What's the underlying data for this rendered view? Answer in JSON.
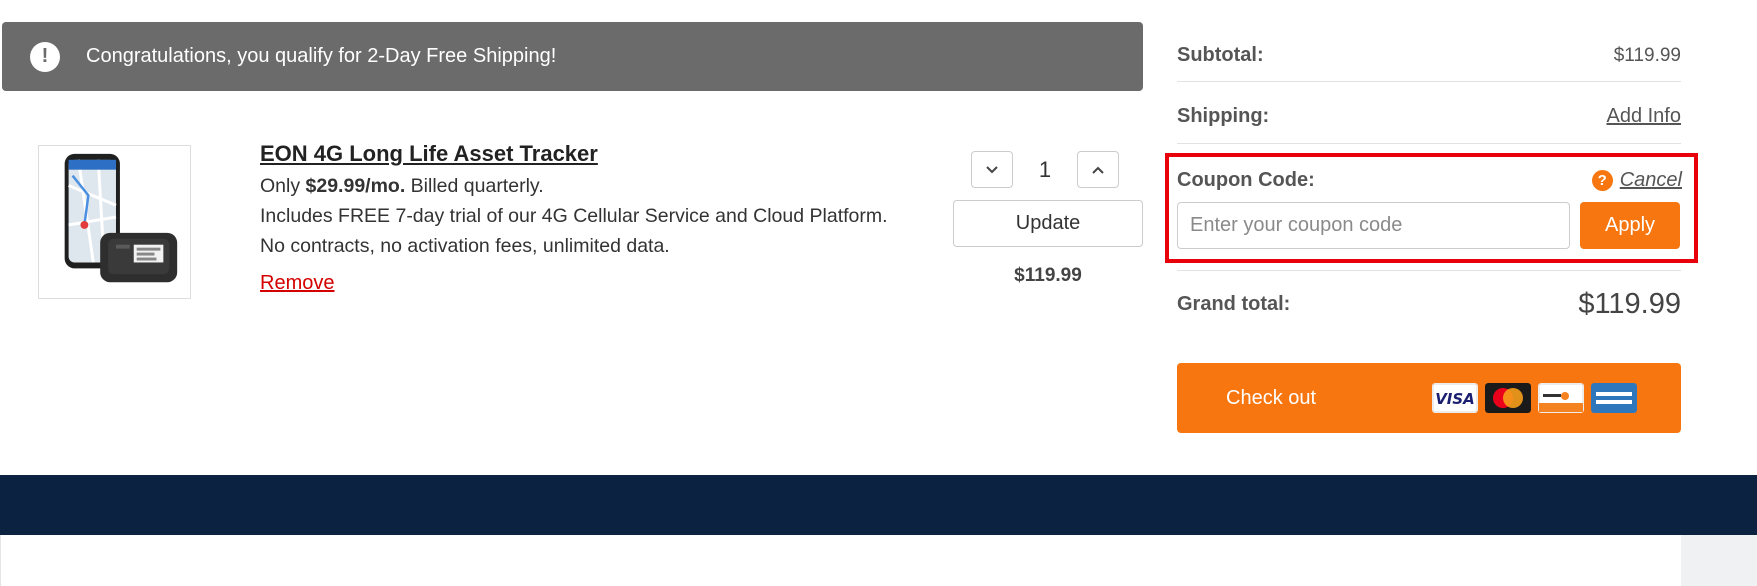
{
  "banner": {
    "icon": "exclamation-circle-icon",
    "text": "Congratulations, you qualify for 2-Day Free Shipping!"
  },
  "product": {
    "title": "EON 4G Long Life Asset Tracker",
    "price_prefix": "Only ",
    "price_bold": "$29.99/mo.",
    "price_suffix": " Billed quarterly.",
    "description": "Includes FREE 7-day trial of our 4G Cellular Service and Cloud Platform. No contracts, no activation fees, unlimited data.",
    "remove_label": "Remove",
    "quantity": "1",
    "update_label": "Update",
    "line_total": "$119.99"
  },
  "summary": {
    "subtotal_label": "Subtotal:",
    "subtotal_value": "$119.99",
    "shipping_label": "Shipping:",
    "shipping_value": "Add Info",
    "coupon_label": "Coupon Code:",
    "coupon_help_icon": "?",
    "coupon_cancel": "Cancel",
    "coupon_placeholder": "Enter your coupon code",
    "coupon_apply": "Apply",
    "grand_total_label": "Grand total:",
    "grand_total_value": "$119.99",
    "checkout_label": "Check out",
    "cards": [
      "visa-icon",
      "mastercard-icon",
      "discover-icon",
      "amex-icon"
    ]
  },
  "colors": {
    "accent": "#f7760f",
    "banner_bg": "#6b6b6b",
    "highlight": "#e8000b",
    "footer": "#0b2341",
    "remove": "#d40000"
  }
}
